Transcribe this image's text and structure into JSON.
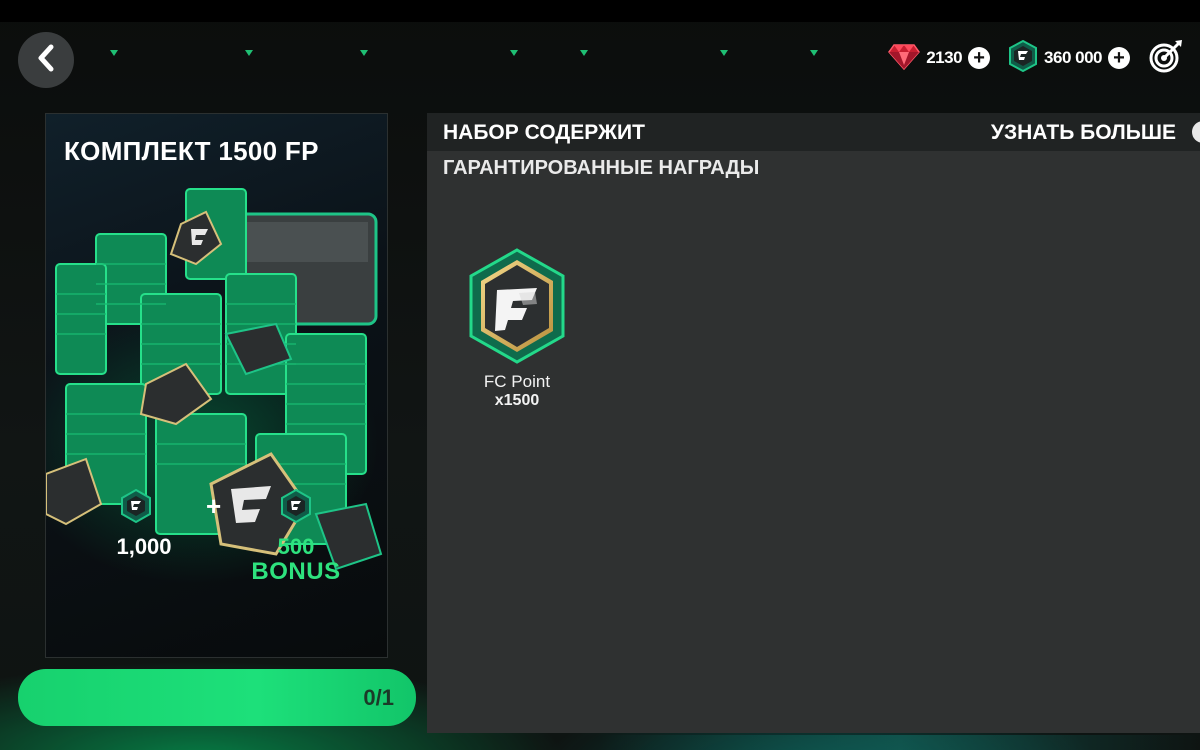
{
  "header": {
    "back_icon": "chevron-left-icon",
    "currencies": [
      {
        "icon": "gem-icon",
        "value": "2130",
        "color": "#e0283a"
      },
      {
        "icon": "fc-points-icon",
        "value": "360 000",
        "color": "#1ec487"
      }
    ],
    "objectives_icon": "target-icon"
  },
  "pack": {
    "title": "КОМПЛЕКТ 1500 FP",
    "base_amount": "1,000",
    "plus_sign": "+",
    "bonus_amount": "500",
    "bonus_label": "BONUS",
    "progress_text": "0/1",
    "progress_fraction": 0
  },
  "content": {
    "contains_title": "НАБОР СОДЕРЖИТ",
    "learn_more": "УЗНАТЬ БОЛЬШЕ",
    "guaranteed_title": "ГАРАНТИРОВАННЫЕ НАГРАДЫ",
    "rewards": [
      {
        "icon": "fc-points-icon",
        "name": "FC Point",
        "quantity": "x1500"
      }
    ]
  },
  "colors": {
    "accent_green": "#1de07a",
    "bonus_green": "#2ee27e",
    "panel_bg": "#2f3131",
    "header_bg": "#202323",
    "gem_red": "#e0283a"
  }
}
